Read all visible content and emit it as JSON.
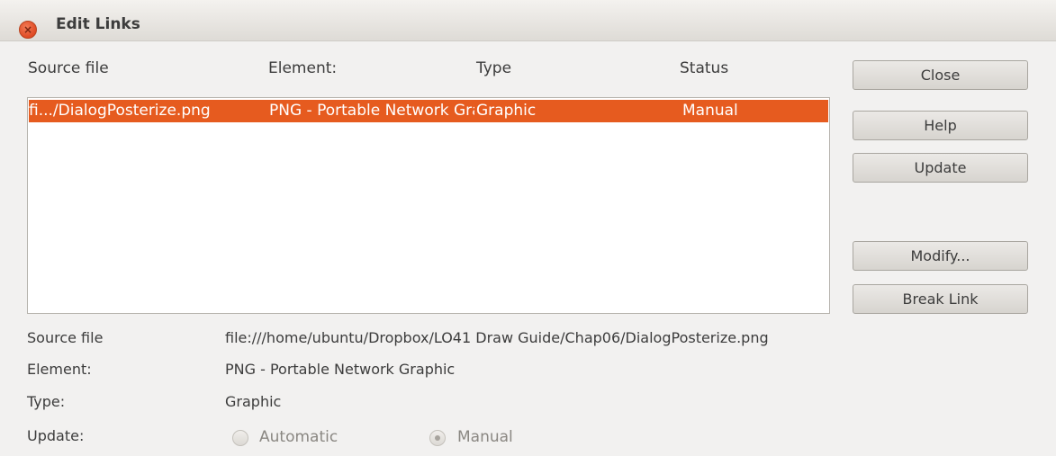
{
  "window": {
    "title": "Edit Links"
  },
  "columns": [
    "Source file",
    "Element:",
    "Type",
    "Status"
  ],
  "links": [
    {
      "source": "fi.../DialogPosterize.png",
      "element": "PNG - Portable Network Graphic",
      "type": "Graphic",
      "status": "Manual"
    }
  ],
  "buttons": {
    "close": "Close",
    "help": "Help",
    "update": "Update",
    "modify": "Modify...",
    "break_link": "Break Link"
  },
  "details": {
    "source_label": "Source file",
    "source_value": "file:///home/ubuntu/Dropbox/LO41 Draw Guide/Chap06/DialogPosterize.png",
    "element_label": "Element:",
    "element_value": "PNG - Portable Network Graphic",
    "type_label": "Type:",
    "type_value": "Graphic",
    "update_label": "Update:"
  },
  "update_mode": {
    "automatic": "Automatic",
    "manual": "Manual",
    "selected": "Manual"
  },
  "colors": {
    "selection": "#e65b1f",
    "close_button": "#df4a24"
  }
}
